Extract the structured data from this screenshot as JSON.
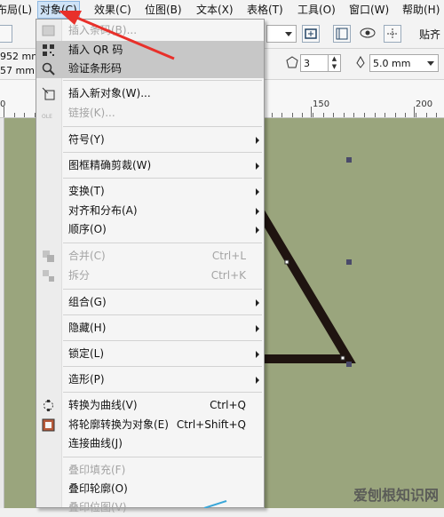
{
  "menubar": {
    "items": [
      {
        "label": "布局(L)"
      },
      {
        "label": "对象(C)"
      },
      {
        "label": "效果(C)"
      },
      {
        "label": "位图(B)"
      },
      {
        "label": "文本(X)"
      },
      {
        "label": "表格(T)"
      },
      {
        "label": "工具(O)"
      },
      {
        "label": "窗口(W)"
      },
      {
        "label": "帮助(H)"
      }
    ]
  },
  "toolbar": {
    "coord_x": "952 mm",
    "coord_y": "57 mm",
    "paste_label": "贴齐",
    "sides_value": "3",
    "outline_width": "5.0 mm"
  },
  "ruler": {
    "labels": [
      "0",
      "150",
      "200"
    ]
  },
  "dropdown": {
    "items": [
      {
        "label": "插入条码(B)...",
        "disabled": true
      },
      {
        "label": "插入 QR 码",
        "highlight": true
      },
      {
        "label": "验证条形码",
        "highlight": true
      },
      {
        "label": "插入新对象(W)..."
      },
      {
        "label": "链接(K)...",
        "disabled": true
      },
      {
        "label": "符号(Y)"
      },
      {
        "label": "图框精确剪裁(W)"
      },
      {
        "label": "变换(T)"
      },
      {
        "label": "对齐和分布(A)"
      },
      {
        "label": "顺序(O)"
      },
      {
        "label": "合并(C)",
        "shortcut": "Ctrl+L",
        "disabled": true
      },
      {
        "label": "拆分",
        "shortcut": "Ctrl+K",
        "disabled": true
      },
      {
        "label": "组合(G)"
      },
      {
        "label": "隐藏(H)"
      },
      {
        "label": "锁定(L)"
      },
      {
        "label": "造形(P)"
      },
      {
        "label": "转换为曲线(V)",
        "shortcut": "Ctrl+Q"
      },
      {
        "label": "将轮廓转换为对象(E)",
        "shortcut": "Ctrl+Shift+Q"
      },
      {
        "label": "连接曲线(J)"
      },
      {
        "label": "叠印填充(F)",
        "disabled": true
      },
      {
        "label": "叠印轮廓(O)"
      },
      {
        "label": "叠印位图(V)",
        "disabled": true
      }
    ]
  },
  "watermark": {
    "text": "爱刨根知识网"
  },
  "colors": {
    "canvas": "#9aa57d",
    "shape_stroke": "#1f1410",
    "arrow": "#e8302a",
    "highlight": "#c7c7c7"
  }
}
